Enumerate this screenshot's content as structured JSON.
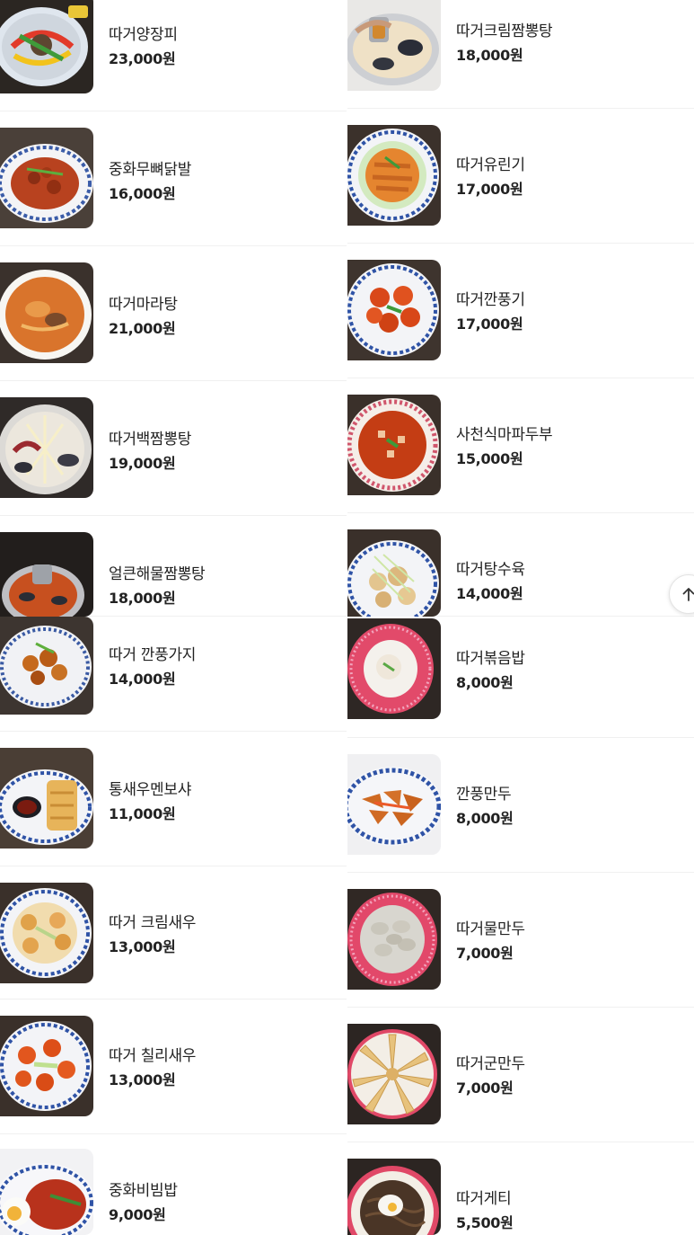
{
  "menu": {
    "left": [
      {
        "name": "따거양장피",
        "price": "23,000원",
        "image": "yangjangpi-photo"
      },
      {
        "name": "중화무뼈닭발",
        "price": "16,000원",
        "image": "boneless-chicken-feet-photo"
      },
      {
        "name": "따거마라탕",
        "price": "21,000원",
        "image": "malatang-photo"
      },
      {
        "name": "따거백짬뽕탕",
        "price": "19,000원",
        "image": "white-jjamppong-photo"
      },
      {
        "name": "얼큰해물짬뽕탕",
        "price": "18,000원",
        "image": "spicy-seafood-jjamppong-photo"
      },
      {
        "name": "따거 깐풍가지",
        "price": "14,000원",
        "image": "kkanpung-eggplant-photo"
      },
      {
        "name": "통새우멘보샤",
        "price": "11,000원",
        "image": "shrimp-menbosha-photo"
      },
      {
        "name": "따거 크림새우",
        "price": "13,000원",
        "image": "cream-shrimp-photo"
      },
      {
        "name": "따거 칠리새우",
        "price": "13,000원",
        "image": "chili-shrimp-photo"
      },
      {
        "name": "중화비빔밥",
        "price": "9,000원",
        "image": "chinese-bibimbap-photo"
      }
    ],
    "right": [
      {
        "name": "따거크림짬뽕탕",
        "price": "18,000원",
        "image": "cream-jjamppong-photo"
      },
      {
        "name": "따거유린기",
        "price": "17,000원",
        "image": "yuringi-photo"
      },
      {
        "name": "따거깐풍기",
        "price": "17,000원",
        "image": "kkanpunggi-photo"
      },
      {
        "name": "사천식마파두부",
        "price": "15,000원",
        "image": "mapo-tofu-photo"
      },
      {
        "name": "따거탕수육",
        "price": "14,000원",
        "image": "tangsuyuk-photo"
      },
      {
        "name": "따거볶음밥",
        "price": "8,000원",
        "image": "fried-rice-photo"
      },
      {
        "name": "깐풍만두",
        "price": "8,000원",
        "image": "kkanpung-dumpling-photo"
      },
      {
        "name": "따거물만두",
        "price": "7,000원",
        "image": "boiled-dumpling-photo"
      },
      {
        "name": "따거군만두",
        "price": "7,000원",
        "image": "fried-dumpling-photo"
      },
      {
        "name": "따거게티",
        "price": "5,500원",
        "image": "ggetti-photo"
      }
    ]
  },
  "scroll_top": {
    "icon": "arrow-up-icon"
  },
  "colors": {
    "text": "#222222",
    "divider": "#f0f0f0",
    "page_bg": "#ffffff"
  }
}
